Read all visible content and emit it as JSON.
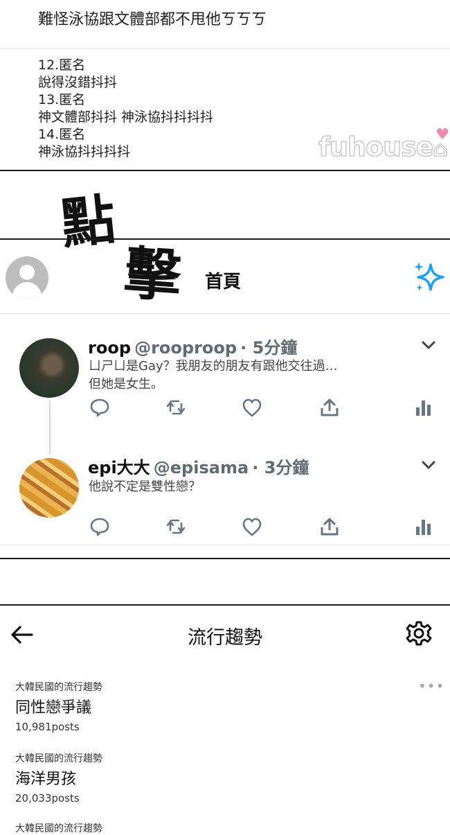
{
  "comment_top": "難怪泳協跟文體部都不甩他ㄎㄎㄎ",
  "comments": [
    {
      "header": "12.匿名",
      "body": "說得沒錯抖抖"
    },
    {
      "header": "13.匿名",
      "body": "神文體部抖抖 神泳協抖抖抖抖"
    },
    {
      "header": "14.匿名",
      "body": "神泳協抖抖抖抖"
    }
  ],
  "watermark": "fuhouse",
  "handwritten": {
    "char1": "點",
    "char2": "擊"
  },
  "timeline": {
    "title": "首頁",
    "tweets": [
      {
        "name": "roop",
        "handle": "@rooproop",
        "time": "· 5分鐘",
        "line1": "ㄩㄕㄩ是Gay？我朋友的朋友有跟他交往過…",
        "line2": "但她是女生。"
      },
      {
        "name": "epi大大",
        "handle": "@episama",
        "time": "· 3分鐘",
        "line1": "他說不定是雙性戀？",
        "line2": ""
      }
    ]
  },
  "trends": {
    "title": "流行趨勢",
    "items": [
      {
        "location": "大韓民國的流行趨勢",
        "name": "同性戀爭議",
        "count": "10,981posts"
      },
      {
        "location": "大韓民國的流行趨勢",
        "name": "海洋男孩",
        "count": "20,033posts"
      },
      {
        "location": "大韓民國的流行趨勢"
      }
    ]
  },
  "colors": {
    "divider": "#1a1a1a",
    "icon": "#657786",
    "sparkle": "#1da1f2",
    "heart": "#f08aa6"
  }
}
